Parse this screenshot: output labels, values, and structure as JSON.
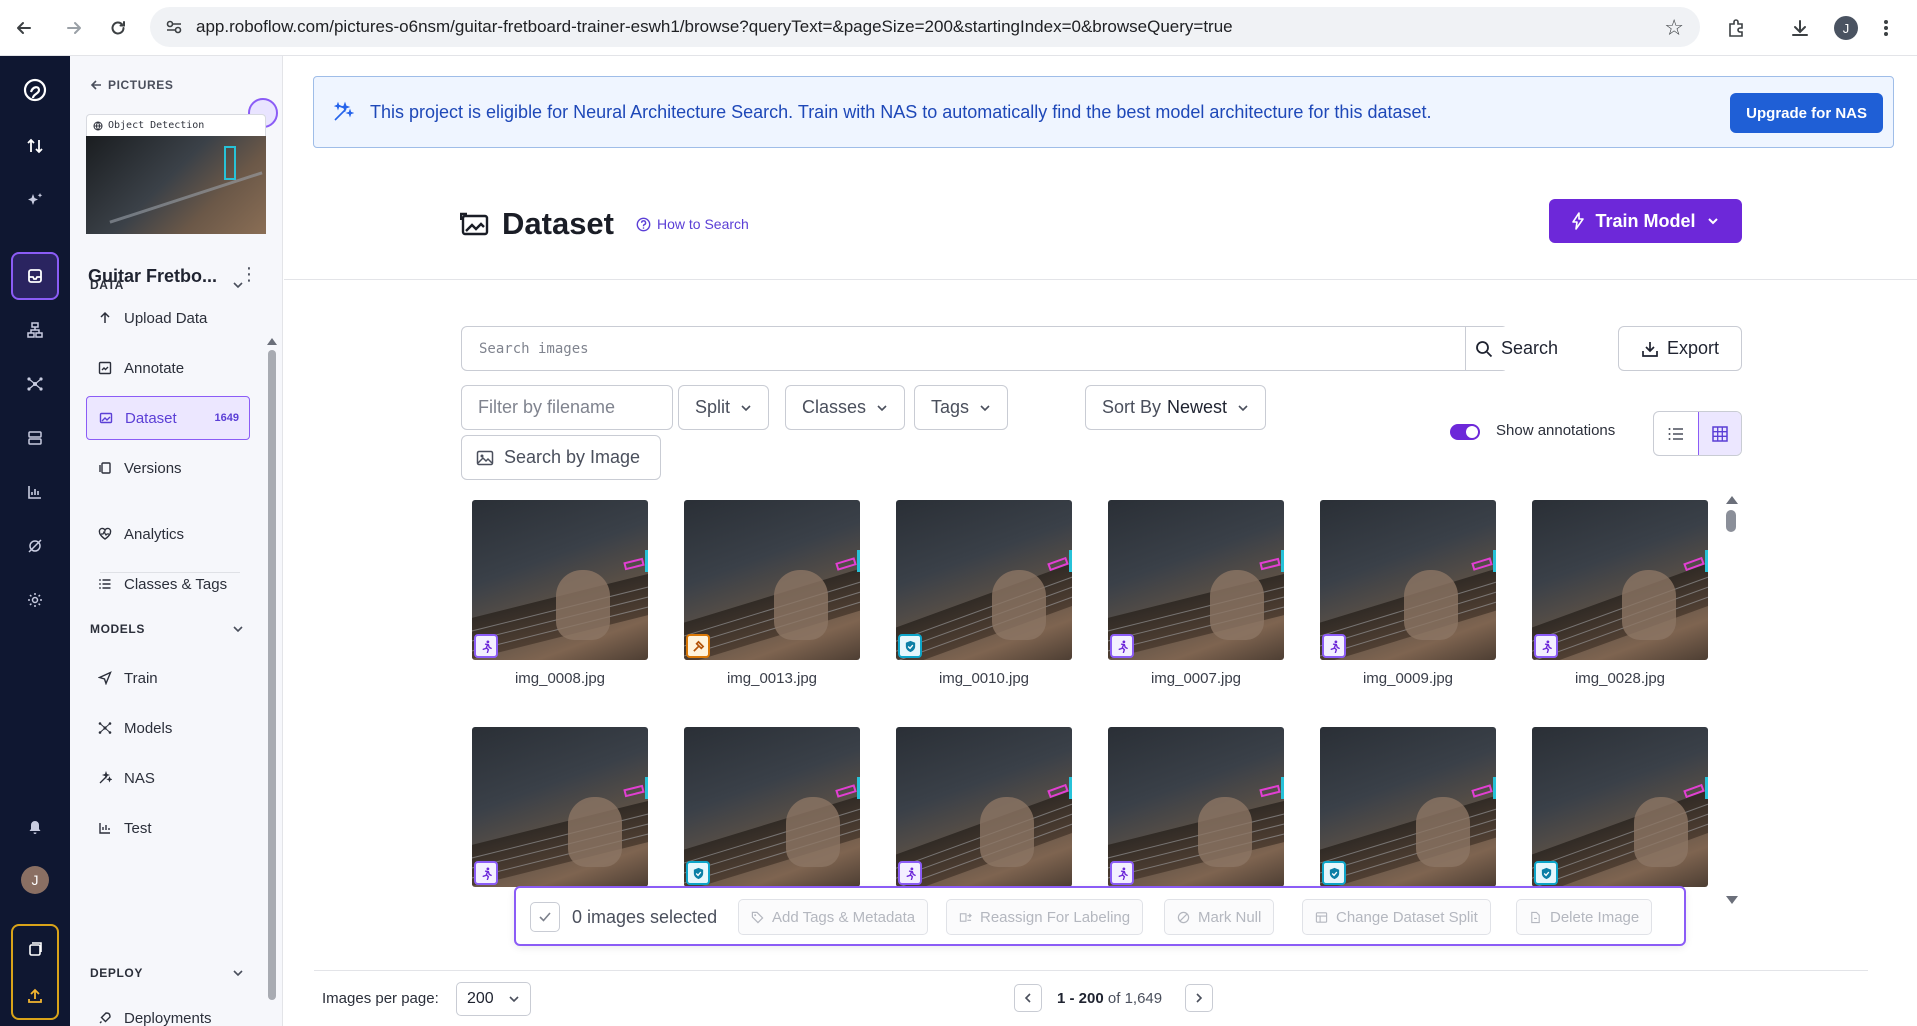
{
  "browser": {
    "url": "app.roboflow.com/pictures-o6nsm/guitar-fretboard-trainer-eswh1/browse?queryText=&pageSize=200&startingIndex=0&browseQuery=true",
    "profile_initial": "J"
  },
  "rail": {
    "avatar_initial": "J"
  },
  "panel": {
    "back_label": "PICTURES",
    "project_type": "Object Detection",
    "project_name": "Guitar Fretbo...",
    "sections": {
      "data": "DATA",
      "models": "MODELS",
      "deploy": "DEPLOY"
    },
    "data_items": [
      {
        "label": "Upload Data",
        "icon": "upload-icon"
      },
      {
        "label": "Annotate",
        "icon": "annotate-icon"
      },
      {
        "label": "Dataset",
        "icon": "dataset-icon",
        "badge": "1649",
        "active": true
      },
      {
        "label": "Versions",
        "icon": "versions-icon"
      },
      {
        "label": "Analytics",
        "icon": "analytics-icon"
      },
      {
        "label": "Classes & Tags",
        "icon": "list-icon"
      }
    ],
    "model_items": [
      {
        "label": "Train",
        "icon": "send-icon"
      },
      {
        "label": "Models",
        "icon": "models-icon"
      },
      {
        "label": "NAS",
        "icon": "wand-icon"
      },
      {
        "label": "Test",
        "icon": "test-icon"
      }
    ],
    "deploy_items": [
      {
        "label": "Deployments",
        "icon": "rocket-icon"
      }
    ]
  },
  "banner": {
    "text": "This project is eligible for Neural Architecture Search. Train with NAS to automatically find the best model architecture for this dataset.",
    "button": "Upgrade for NAS"
  },
  "header": {
    "title": "Dataset",
    "how_to_search": "How to Search",
    "train_button": "Train Model"
  },
  "search": {
    "placeholder": "Search images",
    "button": "Search",
    "export": "Export"
  },
  "filters": {
    "filename_placeholder": "Filter by filename",
    "split": "Split",
    "classes": "Classes",
    "tags": "Tags",
    "sort_label": "Sort By",
    "sort_value": "Newest",
    "search_by_image": "Search by Image",
    "show_annotations": "Show annotations",
    "show_annotations_on": true,
    "view_mode": "grid"
  },
  "images": [
    {
      "name": "img_0008.jpg",
      "tag": "running-person-icon"
    },
    {
      "name": "img_0013.jpg",
      "tag": "hammer-icon"
    },
    {
      "name": "img_0010.jpg",
      "tag": "shield-icon"
    },
    {
      "name": "img_0007.jpg",
      "tag": "running-person-icon"
    },
    {
      "name": "img_0009.jpg",
      "tag": "running-person-icon"
    },
    {
      "name": "img_0028.jpg",
      "tag": "running-person-icon"
    },
    {
      "name": "",
      "tag": "running-person-icon"
    },
    {
      "name": "",
      "tag": "shield-icon"
    },
    {
      "name": "",
      "tag": "running-person-icon"
    },
    {
      "name": "",
      "tag": "running-person-icon"
    },
    {
      "name": "",
      "tag": "shield-icon"
    },
    {
      "name": "",
      "tag": "shield-icon"
    }
  ],
  "selection": {
    "count_text": "0 images selected",
    "actions": [
      "Add Tags & Metadata",
      "Reassign For Labeling",
      "Mark Null",
      "Change Dataset Split",
      "Delete Image"
    ]
  },
  "pagination": {
    "per_page_label": "Images per page:",
    "per_page_value": "200",
    "range": "1 - 200",
    "of_word": "of",
    "total": "1,649"
  },
  "colors": {
    "accent": "#6d28d9",
    "banner_bg": "#eff5ff",
    "banner_button": "#1f5fd6",
    "rail_bg": "#0f1731"
  }
}
